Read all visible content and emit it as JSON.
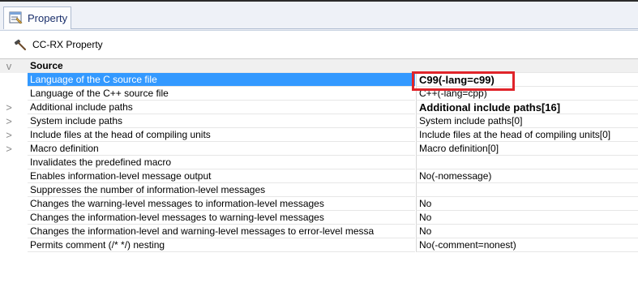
{
  "tab": {
    "label": "Property",
    "icon": "property-page-icon"
  },
  "component": {
    "label": "CC-RX Property",
    "icon": "hammer-icon"
  },
  "category": {
    "label": "Source",
    "expander": "v"
  },
  "rows": [
    {
      "name": "Language of the C source file",
      "value": "C99(-lang=c99)",
      "expander": "",
      "selected": true,
      "bold": true
    },
    {
      "name": "Language of the C++ source file",
      "value": "C++(-lang=cpp)",
      "expander": "",
      "selected": false,
      "bold": false
    },
    {
      "name": "Additional include paths",
      "value": "Additional include paths[16]",
      "expander": ">",
      "selected": false,
      "bold": true
    },
    {
      "name": "System include paths",
      "value": "System include paths[0]",
      "expander": ">",
      "selected": false,
      "bold": false
    },
    {
      "name": "Include files at the head of compiling units",
      "value": "Include files at the head of compiling units[0]",
      "expander": ">",
      "selected": false,
      "bold": false
    },
    {
      "name": "Macro definition",
      "value": "Macro definition[0]",
      "expander": ">",
      "selected": false,
      "bold": false
    },
    {
      "name": "Invalidates the predefined macro",
      "value": "",
      "expander": "",
      "selected": false,
      "bold": false
    },
    {
      "name": "Enables information-level message output",
      "value": "No(-nomessage)",
      "expander": "",
      "selected": false,
      "bold": false
    },
    {
      "name": "Suppresses the number of information-level messages",
      "value": "",
      "expander": "",
      "selected": false,
      "bold": false
    },
    {
      "name": "Changes the warning-level messages to information-level messages",
      "value": "No",
      "expander": "",
      "selected": false,
      "bold": false
    },
    {
      "name": "Changes the information-level messages to warning-level messages",
      "value": "No",
      "expander": "",
      "selected": false,
      "bold": false
    },
    {
      "name": "Changes the information-level and warning-level messages to error-level messa",
      "value": "No",
      "expander": "",
      "selected": false,
      "bold": false
    },
    {
      "name": "Permits comment (/* */) nesting",
      "value": "No(-comment=nonest)",
      "expander": "",
      "selected": false,
      "bold": false
    }
  ],
  "colors": {
    "selection": "#3399ff",
    "highlight_box": "#e0242a",
    "tab_text": "#1a2f6b"
  }
}
